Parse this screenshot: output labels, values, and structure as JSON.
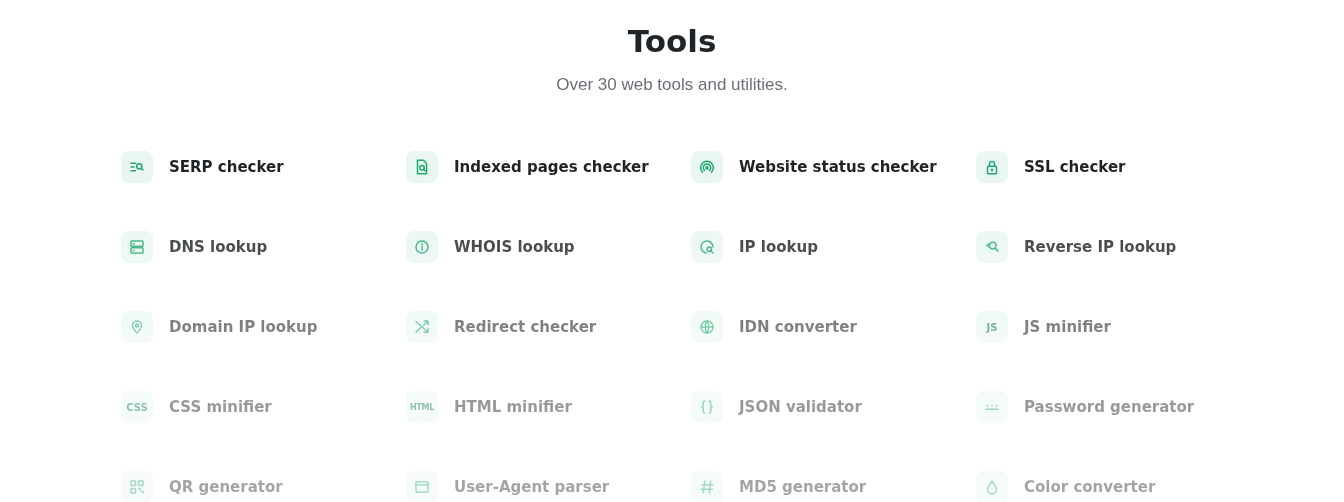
{
  "heading": {
    "title": "Tools",
    "subtitle": "Over 30 web tools and utilities."
  },
  "tools": [
    {
      "label": "SERP checker"
    },
    {
      "label": "Indexed pages checker"
    },
    {
      "label": "Website status checker"
    },
    {
      "label": "SSL checker"
    },
    {
      "label": "DNS lookup"
    },
    {
      "label": "WHOIS lookup"
    },
    {
      "label": "IP lookup"
    },
    {
      "label": "Reverse IP lookup"
    },
    {
      "label": "Domain IP lookup"
    },
    {
      "label": "Redirect checker"
    },
    {
      "label": "IDN converter"
    },
    {
      "label": "JS minifier",
      "badge": "JS"
    },
    {
      "label": "CSS minifier",
      "badge": "CSS"
    },
    {
      "label": "HTML minifier",
      "badge": "HTML"
    },
    {
      "label": "JSON validator"
    },
    {
      "label": "Password generator"
    },
    {
      "label": "QR generator"
    },
    {
      "label": "User-Agent parser"
    },
    {
      "label": "MD5 generator"
    },
    {
      "label": "Color converter"
    }
  ]
}
